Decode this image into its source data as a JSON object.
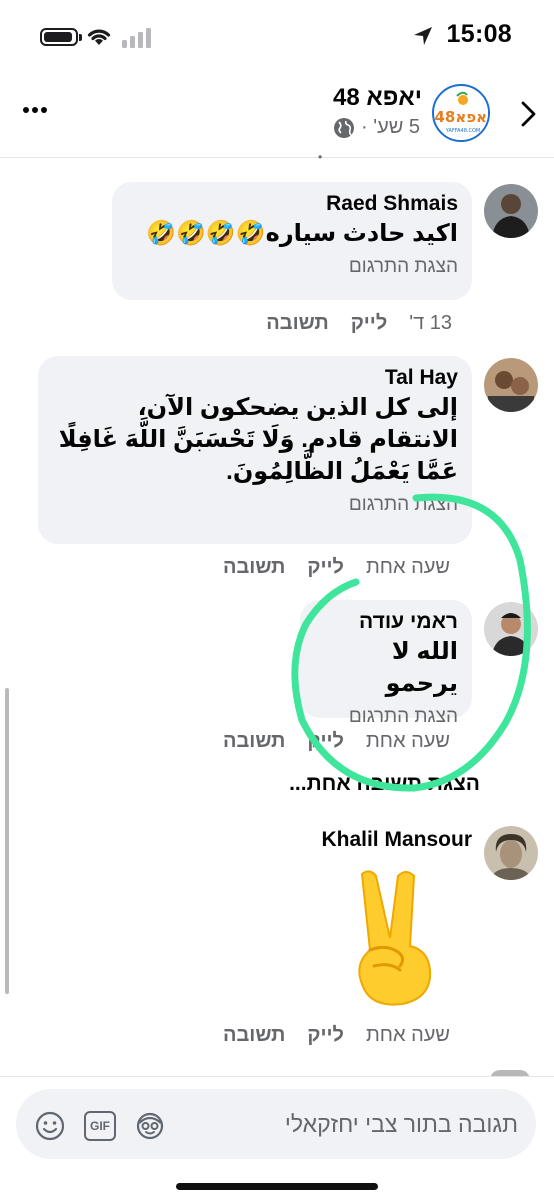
{
  "status_bar": {
    "time": "15:08"
  },
  "header": {
    "page_name": "יאפא 48",
    "post_age": "5 שע' ·",
    "logo_text": "יאפא48",
    "logo_sub": "YAFFA48.COM"
  },
  "comments": [
    {
      "author": "Raed Shmais",
      "text": "اكيد حادث سياره🤣🤣🤣🤣",
      "translate": "הצגת התרגום",
      "time": "13 ד'",
      "like": "לייק",
      "reply": "תשובה"
    },
    {
      "author": "Tal Hay",
      "text": "إلى كل الذين يضحكون الآن، الانتقام قادم. وَلَا تَحْسَبَنَّ اللَّهَ غَافِلًا عَمَّا يَعْمَلُ الظَّالِمُونَ.",
      "translate": "הצגת התרגום",
      "time": "שעה אחת",
      "like": "לייק",
      "reply": "תשובה"
    },
    {
      "author": "ראמי עודה",
      "text": "الله لا يرحمو",
      "translate": "הצגת התרגום",
      "time": "שעה אחת",
      "like": "לייק",
      "reply": "תשובה"
    },
    {
      "author": "Khalil Mansour",
      "emoji": "victory-hand",
      "time": "שעה אחת",
      "like": "לייק",
      "reply": "תשובה"
    }
  ],
  "more_replies": "הצגת תשובה אחת...",
  "composer": {
    "placeholder": "תגובה בתור צבי יחזקאלי",
    "gif_label": "GIF"
  },
  "colors": {
    "bubble": "#f0f2f5",
    "secondary_text": "#65676b",
    "highlight": "#3ee59a",
    "page_ring": "#1a6fd0"
  }
}
